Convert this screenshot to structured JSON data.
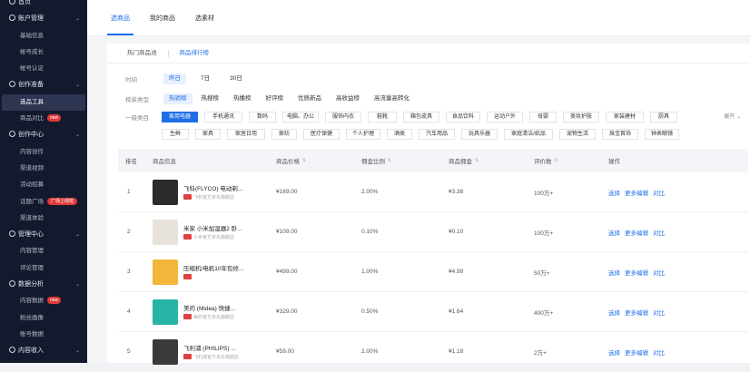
{
  "sidebar": {
    "items": [
      {
        "label": "首页",
        "type": "group"
      },
      {
        "label": "账户管理",
        "type": "group"
      },
      {
        "label": "基础信息",
        "type": "item"
      },
      {
        "label": "帐号成长",
        "type": "item"
      },
      {
        "label": "帐号认证",
        "type": "item"
      },
      {
        "label": "创作准备",
        "type": "group"
      },
      {
        "label": "选品工具",
        "type": "item",
        "active": true
      },
      {
        "label": "商品对比",
        "type": "item",
        "badge": "new"
      },
      {
        "label": "创作中心",
        "type": "group"
      },
      {
        "label": "内容创作",
        "type": "item"
      },
      {
        "label": "渠道视频",
        "type": "item"
      },
      {
        "label": "活动招募",
        "type": "item"
      },
      {
        "label": "话题广场",
        "type": "item",
        "badge": "广场上线啦"
      },
      {
        "label": "渠道体验",
        "type": "item"
      },
      {
        "label": "管理中心",
        "type": "group"
      },
      {
        "label": "内容管理",
        "type": "item"
      },
      {
        "label": "评论管理",
        "type": "item"
      },
      {
        "label": "数据分析",
        "type": "group"
      },
      {
        "label": "内容数据",
        "type": "item",
        "badge": "new"
      },
      {
        "label": "粉丝画像",
        "type": "item"
      },
      {
        "label": "账号数据",
        "type": "item"
      },
      {
        "label": "内容收入",
        "type": "group"
      }
    ]
  },
  "topbar": {
    "tabs": [
      {
        "label": "选商品",
        "active": true
      },
      {
        "label": "我的商品",
        "active": false
      },
      {
        "label": "选素材",
        "active": false
      }
    ]
  },
  "subtabs": [
    {
      "label": "热门商品池",
      "active": false
    },
    {
      "label": "商品排行榜",
      "active": true
    }
  ],
  "filters": {
    "time": {
      "label": "时间",
      "options": [
        {
          "label": "昨日",
          "active": true
        },
        {
          "label": "7日",
          "active": false
        },
        {
          "label": "30日",
          "active": false
        }
      ]
    },
    "rank_type": {
      "label": "榜单类型",
      "options": [
        {
          "label": "热销榜",
          "active": true
        },
        {
          "label": "热搜榜",
          "active": false
        },
        {
          "label": "热播榜",
          "active": false
        },
        {
          "label": "好评榜",
          "active": false
        },
        {
          "label": "优质新品",
          "active": false
        },
        {
          "label": "高收益榜",
          "active": false
        },
        {
          "label": "高流量高转化",
          "active": false
        }
      ]
    },
    "category": {
      "label": "一级类目",
      "collapse_label": "展开",
      "row1": [
        "家用电器",
        "手机通讯",
        "数码",
        "电脑、办公",
        "服饰内衣",
        "鞋靴",
        "箱包皮具",
        "食品饮料",
        "运动户外",
        "母婴",
        "美妆护肤",
        "家装建材",
        "厨具"
      ],
      "row2": [
        "生鲜",
        "家具",
        "家居日用",
        "家纺",
        "医疗保健",
        "个人护理",
        "酒类",
        "汽车用品",
        "玩具乐器",
        "家庭清洁/纸品",
        "宠物生活",
        "珠宝首饰",
        "钟表眼镜"
      ]
    }
  },
  "table": {
    "headers": [
      "排名",
      "商品信息",
      "商品价格",
      "佣金比例",
      "商品佣金",
      "评价数",
      "操作"
    ],
    "actions": [
      "选择",
      "更多编辑",
      "对比"
    ],
    "rows": [
      {
        "rank": "1",
        "name": "飞科(FLYCO) 电动剃...",
        "shop": "飞科官方京东旗舰店",
        "price": "¥169.00",
        "rate": "2.00%",
        "commission": "¥3.38",
        "reviews": "100万+",
        "thumb": "#2b2b2b"
      },
      {
        "rank": "2",
        "name": "米家 小米加湿器2 卧...",
        "shop": "小米官方京东旗舰店",
        "price": "¥109.00",
        "rate": "0.10%",
        "commission": "¥0.10",
        "reviews": "100万+",
        "thumb": "#e7e2da"
      },
      {
        "rank": "3",
        "name": "压缩机/电机10年包修...",
        "shop": "",
        "price": "¥499.00",
        "rate": "1.00%",
        "commission": "¥4.99",
        "reviews": "50万+",
        "thumb": "#f3b63a"
      },
      {
        "rank": "4",
        "name": "美的 (Midea) 快捷...",
        "shop": "美的官方京东旗舰店",
        "price": "¥329.00",
        "rate": "0.50%",
        "commission": "¥1.64",
        "reviews": "400万+",
        "thumb": "#28b3a7"
      },
      {
        "rank": "5",
        "name": "飞利浦 (PHILIPS) ...",
        "shop": "飞利浦官方京东旗舰店",
        "price": "¥59.00",
        "rate": "2.00%",
        "commission": "¥1.18",
        "reviews": "2万+",
        "thumb": "#3a3a3a"
      }
    ]
  }
}
